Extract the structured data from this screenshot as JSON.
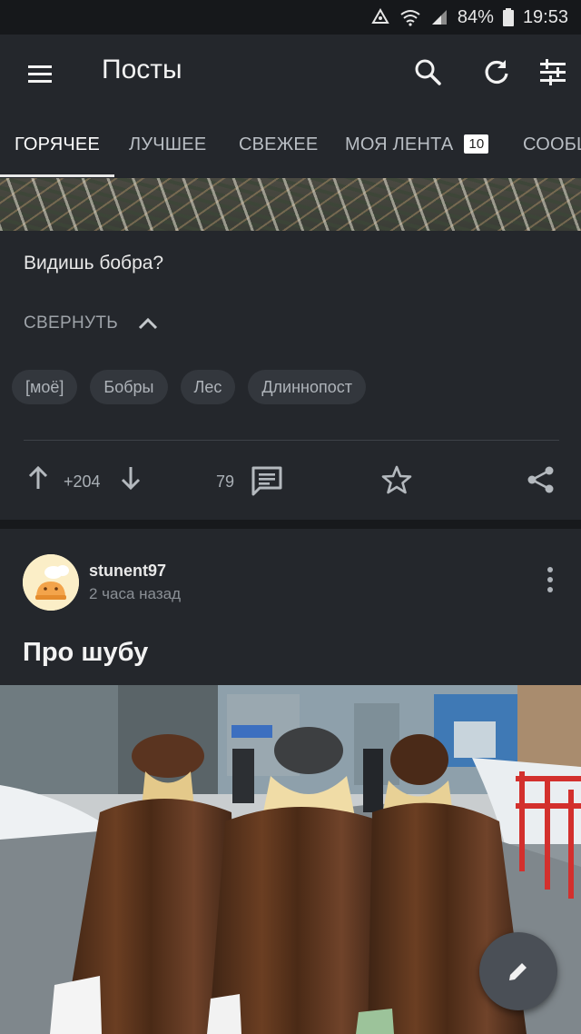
{
  "status_bar": {
    "battery": "84%",
    "time": "19:53"
  },
  "appbar": {
    "title": "Посты"
  },
  "tabs": [
    {
      "label": "ГОРЯЧЕЕ",
      "active": true
    },
    {
      "label": "ЛУЧШЕЕ"
    },
    {
      "label": "СВЕЖЕЕ"
    },
    {
      "label": "МОЯ ЛЕНТА",
      "badge": "10"
    },
    {
      "label": "СООБЩ"
    }
  ],
  "post1": {
    "text": "Видишь бобра?",
    "collapse_label": "СВЕРНУТЬ",
    "tags": [
      "[моё]",
      "Бобры",
      "Лес",
      "Длиннопост"
    ],
    "rating": "+204",
    "comments": "79"
  },
  "post2": {
    "username": "stunent97",
    "time": "2 часа назад",
    "title": "Про шубу"
  },
  "icons": {
    "menu": "menu-icon",
    "search": "search-icon",
    "refresh": "refresh-icon",
    "filter": "filter-icon",
    "upvote": "arrow-up-icon",
    "downvote": "arrow-down-icon",
    "comments": "comment-icon",
    "favorite": "star-icon",
    "share": "share-icon",
    "more": "more-vert-icon",
    "fab": "pencil-icon"
  },
  "colors": {
    "background": "#1b1e21",
    "card": "#24272c",
    "tag_bg": "#33373d"
  }
}
